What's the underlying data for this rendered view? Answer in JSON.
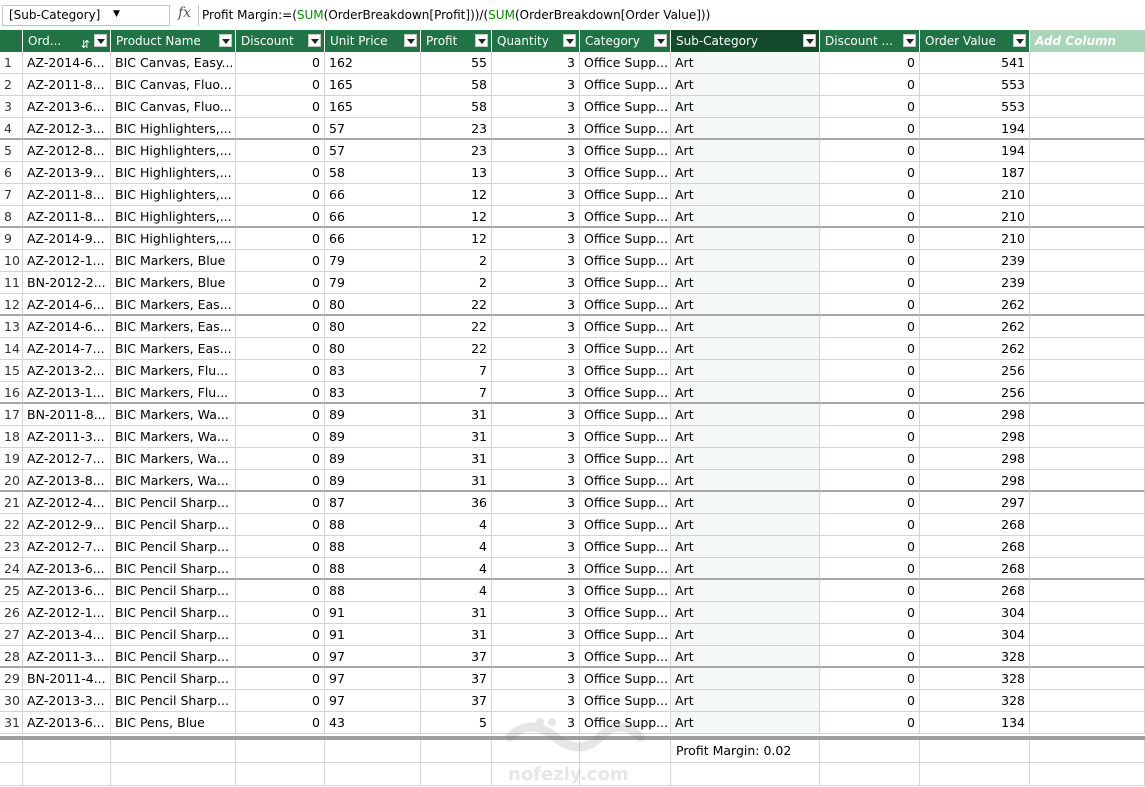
{
  "formula_bar": {
    "name_box": "[Sub-Category]",
    "fx_label": "fx",
    "formula_prefix": "Profit Margin:=(",
    "fn1": "SUM",
    "arg1": "(OrderBreakdown[Profit]))/(",
    "fn2": "SUM",
    "arg2": "(OrderBreakdown[Order Value]))"
  },
  "columns": [
    {
      "label": "Ord...",
      "align": "left"
    },
    {
      "label": "Product Name",
      "align": "left"
    },
    {
      "label": "Discount",
      "align": "right"
    },
    {
      "label": "Unit Price",
      "align": "left"
    },
    {
      "label": "Profit",
      "align": "right"
    },
    {
      "label": "Quantity",
      "align": "right"
    },
    {
      "label": "Category",
      "align": "left"
    },
    {
      "label": "Sub-Category",
      "align": "left"
    },
    {
      "label": "Discount ...",
      "align": "right"
    },
    {
      "label": "Order Value",
      "align": "right"
    }
  ],
  "add_column_label": "Add Column",
  "rows": [
    [
      "1",
      "AZ-2014-6...",
      "BIC Canvas, Easy...",
      "0",
      "162",
      "55",
      "3",
      "Office Supp...",
      "Art",
      "0",
      "541"
    ],
    [
      "2",
      "AZ-2011-8...",
      "BIC Canvas, Fluo...",
      "0",
      "165",
      "58",
      "3",
      "Office Supp...",
      "Art",
      "0",
      "553"
    ],
    [
      "3",
      "AZ-2013-6...",
      "BIC Canvas, Fluo...",
      "0",
      "165",
      "58",
      "3",
      "Office Supp...",
      "Art",
      "0",
      "553"
    ],
    [
      "4",
      "AZ-2012-3...",
      "BIC Highlighters,...",
      "0",
      "57",
      "23",
      "3",
      "Office Supp...",
      "Art",
      "0",
      "194"
    ],
    [
      "5",
      "AZ-2012-8...",
      "BIC Highlighters,...",
      "0",
      "57",
      "23",
      "3",
      "Office Supp...",
      "Art",
      "0",
      "194"
    ],
    [
      "6",
      "AZ-2013-9...",
      "BIC Highlighters,...",
      "0",
      "58",
      "13",
      "3",
      "Office Supp...",
      "Art",
      "0",
      "187"
    ],
    [
      "7",
      "AZ-2011-8...",
      "BIC Highlighters,...",
      "0",
      "66",
      "12",
      "3",
      "Office Supp...",
      "Art",
      "0",
      "210"
    ],
    [
      "8",
      "AZ-2011-8...",
      "BIC Highlighters,...",
      "0",
      "66",
      "12",
      "3",
      "Office Supp...",
      "Art",
      "0",
      "210"
    ],
    [
      "9",
      "AZ-2014-9...",
      "BIC Highlighters,...",
      "0",
      "66",
      "12",
      "3",
      "Office Supp...",
      "Art",
      "0",
      "210"
    ],
    [
      "10",
      "AZ-2012-1...",
      "BIC Markers, Blue",
      "0",
      "79",
      "2",
      "3",
      "Office Supp...",
      "Art",
      "0",
      "239"
    ],
    [
      "11",
      "BN-2012-2...",
      "BIC Markers, Blue",
      "0",
      "79",
      "2",
      "3",
      "Office Supp...",
      "Art",
      "0",
      "239"
    ],
    [
      "12",
      "AZ-2014-6...",
      "BIC Markers, Eas...",
      "0",
      "80",
      "22",
      "3",
      "Office Supp...",
      "Art",
      "0",
      "262"
    ],
    [
      "13",
      "AZ-2014-6...",
      "BIC Markers, Eas...",
      "0",
      "80",
      "22",
      "3",
      "Office Supp...",
      "Art",
      "0",
      "262"
    ],
    [
      "14",
      "AZ-2014-7...",
      "BIC Markers, Eas...",
      "0",
      "80",
      "22",
      "3",
      "Office Supp...",
      "Art",
      "0",
      "262"
    ],
    [
      "15",
      "AZ-2013-2...",
      "BIC Markers, Flu...",
      "0",
      "83",
      "7",
      "3",
      "Office Supp...",
      "Art",
      "0",
      "256"
    ],
    [
      "16",
      "AZ-2013-1...",
      "BIC Markers, Flu...",
      "0",
      "83",
      "7",
      "3",
      "Office Supp...",
      "Art",
      "0",
      "256"
    ],
    [
      "17",
      "BN-2011-8...",
      "BIC Markers, Wa...",
      "0",
      "89",
      "31",
      "3",
      "Office Supp...",
      "Art",
      "0",
      "298"
    ],
    [
      "18",
      "AZ-2011-3...",
      "BIC Markers, Wa...",
      "0",
      "89",
      "31",
      "3",
      "Office Supp...",
      "Art",
      "0",
      "298"
    ],
    [
      "19",
      "AZ-2012-7...",
      "BIC Markers, Wa...",
      "0",
      "89",
      "31",
      "3",
      "Office Supp...",
      "Art",
      "0",
      "298"
    ],
    [
      "20",
      "AZ-2013-8...",
      "BIC Markers, Wa...",
      "0",
      "89",
      "31",
      "3",
      "Office Supp...",
      "Art",
      "0",
      "298"
    ],
    [
      "21",
      "AZ-2012-4...",
      "BIC Pencil Sharp...",
      "0",
      "87",
      "36",
      "3",
      "Office Supp...",
      "Art",
      "0",
      "297"
    ],
    [
      "22",
      "AZ-2012-9...",
      "BIC Pencil Sharp...",
      "0",
      "88",
      "4",
      "3",
      "Office Supp...",
      "Art",
      "0",
      "268"
    ],
    [
      "23",
      "AZ-2012-7...",
      "BIC Pencil Sharp...",
      "0",
      "88",
      "4",
      "3",
      "Office Supp...",
      "Art",
      "0",
      "268"
    ],
    [
      "24",
      "AZ-2013-6...",
      "BIC Pencil Sharp...",
      "0",
      "88",
      "4",
      "3",
      "Office Supp...",
      "Art",
      "0",
      "268"
    ],
    [
      "25",
      "AZ-2013-6...",
      "BIC Pencil Sharp...",
      "0",
      "88",
      "4",
      "3",
      "Office Supp...",
      "Art",
      "0",
      "268"
    ],
    [
      "26",
      "AZ-2012-1...",
      "BIC Pencil Sharp...",
      "0",
      "91",
      "31",
      "3",
      "Office Supp...",
      "Art",
      "0",
      "304"
    ],
    [
      "27",
      "AZ-2013-4...",
      "BIC Pencil Sharp...",
      "0",
      "91",
      "31",
      "3",
      "Office Supp...",
      "Art",
      "0",
      "304"
    ],
    [
      "28",
      "AZ-2011-3...",
      "BIC Pencil Sharp...",
      "0",
      "97",
      "37",
      "3",
      "Office Supp...",
      "Art",
      "0",
      "328"
    ],
    [
      "29",
      "BN-2011-4...",
      "BIC Pencil Sharp...",
      "0",
      "97",
      "37",
      "3",
      "Office Supp...",
      "Art",
      "0",
      "328"
    ],
    [
      "30",
      "AZ-2013-3...",
      "BIC Pencil Sharp...",
      "0",
      "97",
      "37",
      "3",
      "Office Supp...",
      "Art",
      "0",
      "328"
    ],
    [
      "31",
      "AZ-2013-6...",
      "BIC Pens, Blue",
      "0",
      "43",
      "5",
      "3",
      "Office Supp...",
      "Art",
      "0",
      "134"
    ]
  ],
  "measure": "Profit Margin: 0.02",
  "watermark": "nofezly.com",
  "colors": {
    "header": "#217346",
    "header_selected": "#124a2b",
    "add_column": "#a9d5b8",
    "formula_function": "#0a8a00"
  }
}
